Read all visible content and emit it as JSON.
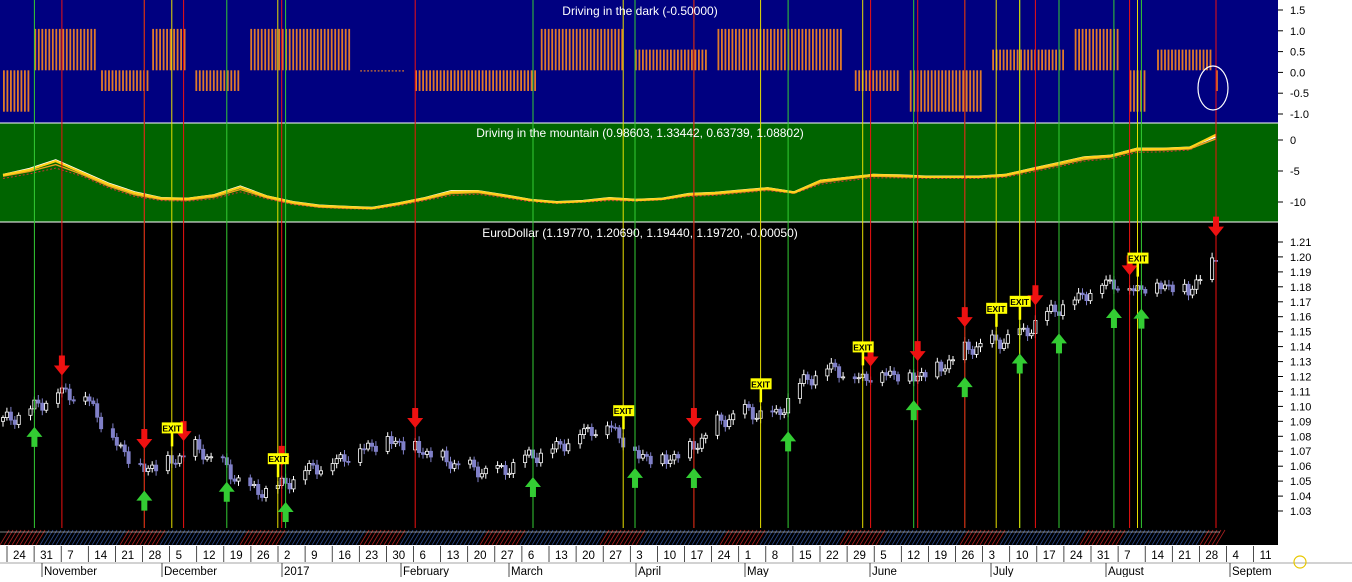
{
  "panels": {
    "dark": {
      "title": "Driving in the dark (-0.50000)",
      "bg": "#000080",
      "bar_color": "#e07a2a",
      "title_color": "#ffffff",
      "axis_ticks": [
        "1.5",
        "1.0",
        "0.5",
        "0.0",
        "-0.5",
        "-1.0"
      ],
      "ylim": [
        -1.2,
        1.6
      ]
    },
    "mountain": {
      "title": "Driving in the mountain (0.98603, 1.33442, 0.63739, 1.08802)",
      "bg": "#006400",
      "title_color": "#ffffff",
      "axis_ticks": [
        "0",
        "-5",
        "-10"
      ],
      "ylim": [
        -13,
        2.5
      ],
      "line_colors": [
        "#ffffff",
        "#ffd21a",
        "#e8a020",
        "#cc3333"
      ]
    },
    "price": {
      "title": "EuroDollar (1.19770, 1.20690, 1.19440, 1.19720, -0.00050)",
      "bg": "#000000",
      "title_color": "#ffffff",
      "axis_ticks": [
        "1.21",
        "1.20",
        "1.19",
        "1.18",
        "1.17",
        "1.16",
        "1.15",
        "1.14",
        "1.13",
        "1.12",
        "1.11",
        "1.10",
        "1.09",
        "1.08",
        "1.07",
        "1.06",
        "1.05",
        "1.04",
        "1.03"
      ],
      "ylim": [
        1.022,
        1.222
      ],
      "up_color": "#ffffff",
      "down_color": "#8080c8",
      "buy_color": "#33cc33",
      "sell_color": "#ee1111",
      "exit_bg": "#ffff00",
      "exit_label": "EXIT"
    }
  },
  "x_axis": {
    "day_labels": [
      "24",
      "31",
      "7",
      "14",
      "21",
      "28",
      "5",
      "12",
      "19",
      "26",
      "2",
      "9",
      "16",
      "23",
      "30",
      "6",
      "13",
      "20",
      "27",
      "6",
      "13",
      "20",
      "27",
      "3",
      "10",
      "17",
      "24",
      "1",
      "8",
      "15",
      "22",
      "29",
      "5",
      "12",
      "19",
      "26",
      "3",
      "10",
      "17",
      "24",
      "31",
      "7",
      "14",
      "21",
      "28",
      "4",
      "11"
    ],
    "month_labels": [
      "November",
      "December",
      "2017",
      "February",
      "March",
      "April",
      "May",
      "June",
      "July",
      "August",
      "Septem"
    ]
  },
  "chart_data": [
    {
      "type": "bar",
      "title": "Driving in the dark (-0.50000)",
      "last_value": -0.5,
      "ylim": [
        -1.2,
        1.6
      ],
      "regimes": [
        {
          "from": "2016-10-24",
          "to": "2016-10-31",
          "value": -1.0
        },
        {
          "from": "2016-11-01",
          "to": "2016-11-17",
          "value": 1.0
        },
        {
          "from": "2016-11-18",
          "to": "2016-11-30",
          "value": -0.5
        },
        {
          "from": "2016-12-01",
          "to": "2016-12-09",
          "value": 1.0
        },
        {
          "from": "2016-12-12",
          "to": "2016-12-23",
          "value": -0.5
        },
        {
          "from": "2016-12-26",
          "to": "2017-01-20",
          "value": 1.0
        },
        {
          "from": "2017-01-23",
          "to": "2017-02-03",
          "value": 0.0
        },
        {
          "from": "2017-02-06",
          "to": "2017-03-09",
          "value": -0.5
        },
        {
          "from": "2017-03-10",
          "to": "2017-03-31",
          "value": 1.0
        },
        {
          "from": "2017-04-03",
          "to": "2017-04-21",
          "value": 0.5
        },
        {
          "from": "2017-04-24",
          "to": "2017-05-26",
          "value": 1.0
        },
        {
          "from": "2017-05-29",
          "to": "2017-06-09",
          "value": -0.5
        },
        {
          "from": "2017-06-12",
          "to": "2017-06-30",
          "value": -1.0
        },
        {
          "from": "2017-07-03",
          "to": "2017-07-21",
          "value": 0.5
        },
        {
          "from": "2017-07-24",
          "to": "2017-08-04",
          "value": 1.0
        },
        {
          "from": "2017-08-07",
          "to": "2017-08-11",
          "value": -1.0
        },
        {
          "from": "2017-08-14",
          "to": "2017-08-28",
          "value": 0.5
        },
        {
          "from": "2017-08-29",
          "to": "2017-08-29",
          "value": -0.5
        }
      ]
    },
    {
      "type": "line",
      "title": "Driving in the mountain (0.98603, 1.33442, 0.63739, 1.08802)",
      "ylim": [
        -13,
        2.5
      ],
      "series": [
        {
          "values": [
            -5.5,
            -4.5,
            -3,
            -5,
            -7,
            -8.5,
            -9.5,
            -9.6,
            -9,
            -7.5,
            -9.2,
            -10.2,
            -10.8,
            -11,
            -11.2,
            -10.4,
            -9.5,
            -8.3,
            -8.3,
            -9,
            -9.8,
            -10.2,
            -10,
            -9.5,
            -9.8,
            -9.6,
            -8.8,
            -8.6,
            -8.2,
            -7.8,
            -8.5,
            -6.5,
            -6,
            -5.5,
            -5.6,
            -5.8,
            -5.8,
            -5.8,
            -5.5,
            -4.5,
            -3.5,
            -2.5,
            -2.2,
            -1,
            -1,
            -0.8,
            0.98
          ]
        },
        {
          "values": [
            -5.6,
            -4.7,
            -3.2,
            -5.2,
            -7.2,
            -8.7,
            -9.6,
            -9.7,
            -9.1,
            -7.7,
            -9.3,
            -10.3,
            -10.9,
            -11.1,
            -11.3,
            -10.5,
            -9.6,
            -8.5,
            -8.4,
            -9.1,
            -9.9,
            -10.3,
            -10.1,
            -9.6,
            -9.9,
            -9.7,
            -8.9,
            -8.7,
            -8.3,
            -7.9,
            -8.6,
            -6.6,
            -6.1,
            -5.6,
            -5.7,
            -5.9,
            -5.9,
            -5.9,
            -5.6,
            -4.6,
            -3.6,
            -2.6,
            -2.3,
            -1.1,
            -1.1,
            -0.9,
            1.33
          ]
        },
        {
          "values": [
            -5.8,
            -5.0,
            -3.8,
            -5.5,
            -7.5,
            -9.0,
            -9.8,
            -9.9,
            -9.4,
            -8.1,
            -9.5,
            -10.5,
            -11.1,
            -11.3,
            -11.4,
            -10.7,
            -9.8,
            -8.8,
            -8.6,
            -9.3,
            -10.0,
            -10.4,
            -10.2,
            -9.8,
            -10.0,
            -9.8,
            -9.1,
            -8.9,
            -8.5,
            -8.1,
            -8.7,
            -6.9,
            -6.3,
            -5.8,
            -5.9,
            -6.0,
            -6.0,
            -6.0,
            -5.8,
            -4.8,
            -3.9,
            -2.9,
            -2.5,
            -1.4,
            -1.3,
            -1.1,
            0.64
          ]
        },
        {
          "values": [
            -6.2,
            -5.4,
            -4.4,
            -5.8,
            -7.8,
            -9.3,
            -10.0,
            -10.1,
            -9.7,
            -8.5,
            -9.7,
            -10.7,
            -11.2,
            -11.4,
            -11.5,
            -10.9,
            -10.0,
            -9.1,
            -8.9,
            -9.5,
            -10.2,
            -10.5,
            -10.3,
            -10.0,
            -10.1,
            -9.9,
            -9.3,
            -9.1,
            -8.7,
            -8.3,
            -8.8,
            -7.2,
            -6.6,
            -6.1,
            -6.1,
            -6.2,
            -6.2,
            -6.2,
            -6.0,
            -5.1,
            -4.2,
            -3.2,
            -2.8,
            -1.7,
            -1.6,
            -1.3,
            1.09
          ]
        }
      ]
    },
    {
      "type": "candlestick",
      "title": "EuroDollar (1.19770, 1.20690, 1.19440, 1.19720, -0.00050)",
      "last": {
        "open": 1.1977,
        "high": 1.2069,
        "low": 1.1944,
        "close": 1.1972,
        "change": -0.0005
      },
      "ylim": [
        1.022,
        1.222
      ],
      "weekly_closes": [
        1.09,
        1.098,
        1.11,
        1.107,
        1.078,
        1.058,
        1.062,
        1.072,
        1.06,
        1.043,
        1.046,
        1.058,
        1.063,
        1.072,
        1.078,
        1.072,
        1.064,
        1.058,
        1.056,
        1.066,
        1.072,
        1.083,
        1.088,
        1.068,
        1.064,
        1.072,
        1.09,
        1.097,
        1.093,
        1.117,
        1.127,
        1.119,
        1.123,
        1.12,
        1.126,
        1.139,
        1.143,
        1.149,
        1.164,
        1.173,
        1.184,
        1.179,
        1.182,
        1.178,
        1.1972
      ],
      "signals": {
        "buy": [
          "2016-11-01",
          "2016-11-29",
          "2016-12-20",
          "2017-01-04",
          "2017-03-08",
          "2017-04-03",
          "2017-04-18",
          "2017-05-12",
          "2017-06-13",
          "2017-06-26",
          "2017-07-10",
          "2017-07-20",
          "2017-08-03",
          "2017-08-10"
        ],
        "sell": [
          "2016-11-08",
          "2016-11-29",
          "2016-12-09",
          "2017-01-03",
          "2017-02-06",
          "2017-04-18",
          "2017-06-02",
          "2017-06-14",
          "2017-06-26",
          "2017-07-14",
          "2017-08-07",
          "2017-08-29"
        ],
        "exit": [
          "2016-12-06",
          "2017-01-02",
          "2017-03-31",
          "2017-05-05",
          "2017-05-31",
          "2017-07-04",
          "2017-07-10",
          "2017-08-09"
        ]
      }
    }
  ]
}
